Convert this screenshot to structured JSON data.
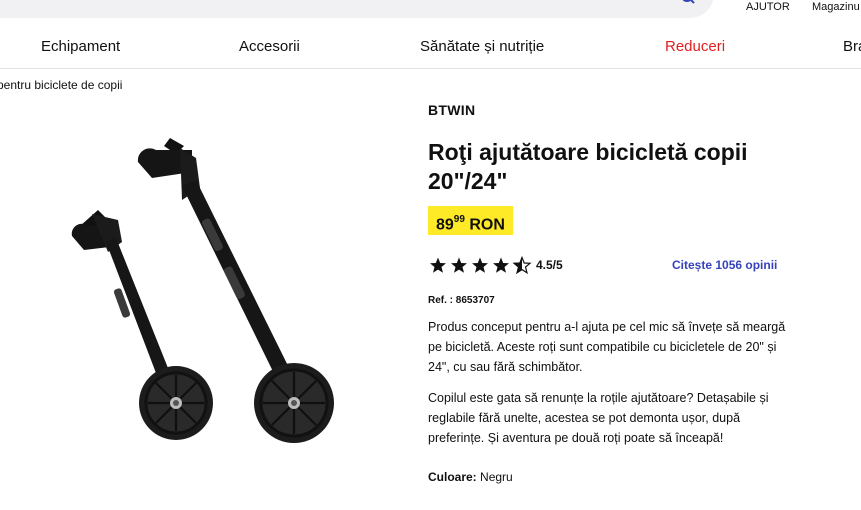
{
  "header": {
    "links": [
      "AJUTOR",
      "Magazinu"
    ]
  },
  "nav": {
    "items": [
      "Echipament",
      "Accesorii",
      "Sănătate și nutriție",
      "Reduceri",
      "Bra"
    ]
  },
  "breadcrumb": "pentru biciclete de copii",
  "product": {
    "brand": "BTWIN",
    "title": "Roţi ajutătoare bicicletă copii 20\"/24\"",
    "price_main": "89",
    "price_cents": "99",
    "currency": "RON",
    "rating": "4.5/5",
    "stars": 4.5,
    "reviews_link": "Citește 1056 opinii",
    "ref": "Ref. : 8653707",
    "description_1": "Produs conceput pentru a-l ajuta pe cel mic să învețe să meargă pe bicicletă. Aceste roți sunt compatibile cu bicicletele de 20\" și 24\", cu sau fără schimbător.",
    "description_2": "Copilul este gata să renunțe la roțile ajutătoare? Detașabile și reglabile fără unelte, acestea se pot demonta ușor, după preferințe. Și aventura pe două roți poate să înceapă!",
    "color_label": "Culoare:",
    "color_value": "Negru"
  },
  "colors": {
    "accent": "#3643ba",
    "price_bg": "#ffea28",
    "sale": "#e02020"
  }
}
